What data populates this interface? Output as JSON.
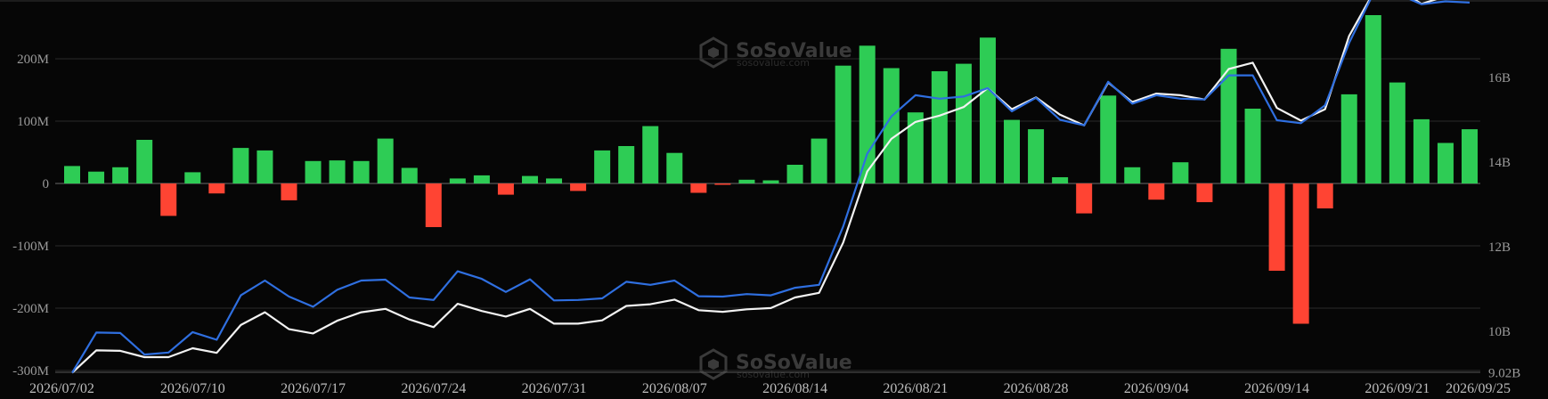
{
  "watermark": {
    "brand": "SoSoValue",
    "domain": "sosovalue.com",
    "icon": "sosovalue-logo-icon"
  },
  "colors": {
    "background": "#060606",
    "positive_bar": "#2ecc55",
    "negative_bar": "#ff4433",
    "line_white": "#f2f2f2",
    "line_blue": "#2f6fe0",
    "grid": "#2a2a2a"
  },
  "chart_data": {
    "type": "bar",
    "grid": true,
    "left_axis": {
      "ticks": [
        "200M",
        "100M",
        "0",
        "-100M",
        "-200M",
        "-300M"
      ],
      "ylim": [
        -300,
        285
      ],
      "unit": "M"
    },
    "right_axis": {
      "ticks": [
        "16B",
        "14B",
        "12B",
        "10B",
        "9.02B"
      ],
      "ylim": [
        9.02,
        17.98
      ],
      "unit": "B"
    },
    "x_tick_labels": [
      "2026/07/02",
      "2026/07/10",
      "2026/07/17",
      "2026/07/24",
      "2026/07/31",
      "2026/08/07",
      "2026/08/14",
      "2026/08/21",
      "2026/08/28",
      "2026/09/04",
      "2026/09/14",
      "2026/09/21",
      "2026/09/25"
    ],
    "series": [
      {
        "kind": "bar",
        "axis": "left",
        "values": [
          28,
          19,
          26,
          70,
          -52,
          18,
          -16,
          57,
          53,
          -27,
          36,
          37,
          36,
          72,
          25,
          -70,
          8,
          13,
          -18,
          12,
          8,
          -12,
          53,
          60,
          92,
          49,
          -15,
          -2,
          6,
          5,
          30,
          72,
          189,
          221,
          185,
          114,
          180,
          192,
          234,
          102,
          87,
          10,
          -48,
          141,
          26,
          -26,
          34,
          -30,
          216,
          120,
          -140,
          -225,
          -40,
          143,
          270,
          162,
          103,
          65,
          87
        ]
      },
      {
        "kind": "line",
        "color": "white",
        "axis": "right",
        "values": [
          9.02,
          9.55,
          9.54,
          9.39,
          9.39,
          9.6,
          9.49,
          10.15,
          10.45,
          10.05,
          9.95,
          10.25,
          10.45,
          10.53,
          10.28,
          10.1,
          10.65,
          10.48,
          10.35,
          10.53,
          10.18,
          10.18,
          10.26,
          10.6,
          10.64,
          10.75,
          10.5,
          10.46,
          10.52,
          10.55,
          10.8,
          10.91,
          12.1,
          13.78,
          14.55,
          14.95,
          15.1,
          15.3,
          15.75,
          15.25,
          15.53,
          15.12,
          14.87,
          15.88,
          15.42,
          15.62,
          15.58,
          15.48,
          16.2,
          16.35,
          15.28,
          14.98,
          15.25,
          16.98,
          18.0,
          18.12,
          17.74,
          17.92,
          18.0
        ]
      },
      {
        "kind": "line",
        "color": "blue",
        "axis": "right",
        "values": [
          9.02,
          9.97,
          9.96,
          9.45,
          9.5,
          9.98,
          9.8,
          10.85,
          11.2,
          10.82,
          10.58,
          10.98,
          11.2,
          11.22,
          10.8,
          10.74,
          11.42,
          11.24,
          10.93,
          11.23,
          10.73,
          10.74,
          10.78,
          11.17,
          11.1,
          11.2,
          10.83,
          10.82,
          10.88,
          10.85,
          11.03,
          11.1,
          12.48,
          14.2,
          15.08,
          15.58,
          15.5,
          15.55,
          15.75,
          15.2,
          15.52,
          15.0,
          14.87,
          15.9,
          15.38,
          15.58,
          15.5,
          15.48,
          16.05,
          16.05,
          14.99,
          14.92,
          15.34,
          16.82,
          17.98,
          17.98,
          17.73,
          17.8,
          17.77
        ]
      }
    ]
  }
}
